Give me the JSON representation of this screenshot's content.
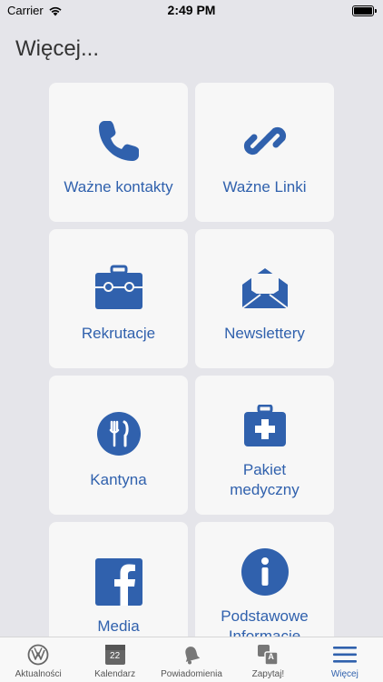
{
  "status": {
    "carrier": "Carrier",
    "time": "2:49 PM"
  },
  "title": "Więcej...",
  "accent": "#3061ad",
  "tiles": [
    {
      "label": "Ważne kontakty",
      "icon": "phone-icon"
    },
    {
      "label": "Ważne Linki",
      "icon": "link-icon"
    },
    {
      "label": "Rekrutacje",
      "icon": "briefcase-icon"
    },
    {
      "label": "Newslettery",
      "icon": "envelope-icon"
    },
    {
      "label": "Kantyna",
      "icon": "cutlery-icon"
    },
    {
      "label": "Pakiet medyczny",
      "icon": "medical-kit-icon"
    },
    {
      "label": "Media",
      "icon": "facebook-icon"
    },
    {
      "label": "Podstawowe Informacje",
      "icon": "info-icon"
    }
  ],
  "tabbar": {
    "items": [
      {
        "label": "Aktualności",
        "icon": "vw-logo-icon"
      },
      {
        "label": "Kalendarz",
        "icon": "calendar-icon",
        "badge": "22"
      },
      {
        "label": "Powiadomienia",
        "icon": "bell-icon"
      },
      {
        "label": "Zapytaj!",
        "icon": "translate-icon",
        "glyph_a": "A"
      },
      {
        "label": "Więcej",
        "icon": "menu-icon",
        "active": true
      }
    ]
  }
}
